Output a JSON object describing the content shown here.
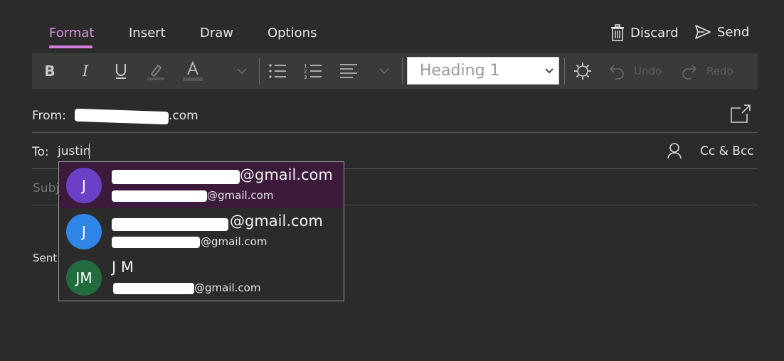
{
  "tabs": [
    {
      "label": "Format",
      "active": true
    },
    {
      "label": "Insert",
      "active": false
    },
    {
      "label": "Draw",
      "active": false
    },
    {
      "label": "Options",
      "active": false
    }
  ],
  "actions": {
    "discard": "Discard",
    "send": "Send"
  },
  "toolbar": {
    "bold_icon": "bold-icon",
    "italic_icon": "italic-icon",
    "underline_icon": "underline-icon",
    "highlight_icon": "highlight-icon",
    "font_color_icon": "font-color-icon",
    "heading_style": "Heading 1",
    "undo": "Undo",
    "redo": "Redo"
  },
  "from": {
    "label": "From:",
    "email_visible": ".com"
  },
  "to": {
    "label": "To:",
    "value": "justin",
    "cc_bcc": "Cc & Bcc"
  },
  "subject": {
    "placeholder": "Subj"
  },
  "body_fragment": "Sent",
  "suggestions": [
    {
      "initials": "J",
      "avatar_color": "#6b3fc6",
      "name_suffix": "@gmail.com",
      "email_suffix": "@gmail.com",
      "name": ""
    },
    {
      "initials": "J",
      "avatar_color": "#2f86e6",
      "name_suffix": "@gmail.com",
      "email_suffix": "@gmail.com",
      "name": ""
    },
    {
      "initials": "JM",
      "avatar_color": "#226b3f",
      "name": "J M",
      "email_suffix": "@gmail.com",
      "name_suffix": ""
    }
  ],
  "colors": {
    "accent": "#d37fdc",
    "background": "#2b2b2b",
    "toolbar": "#3a3a3a",
    "selected_row": "#3b1a3b"
  }
}
